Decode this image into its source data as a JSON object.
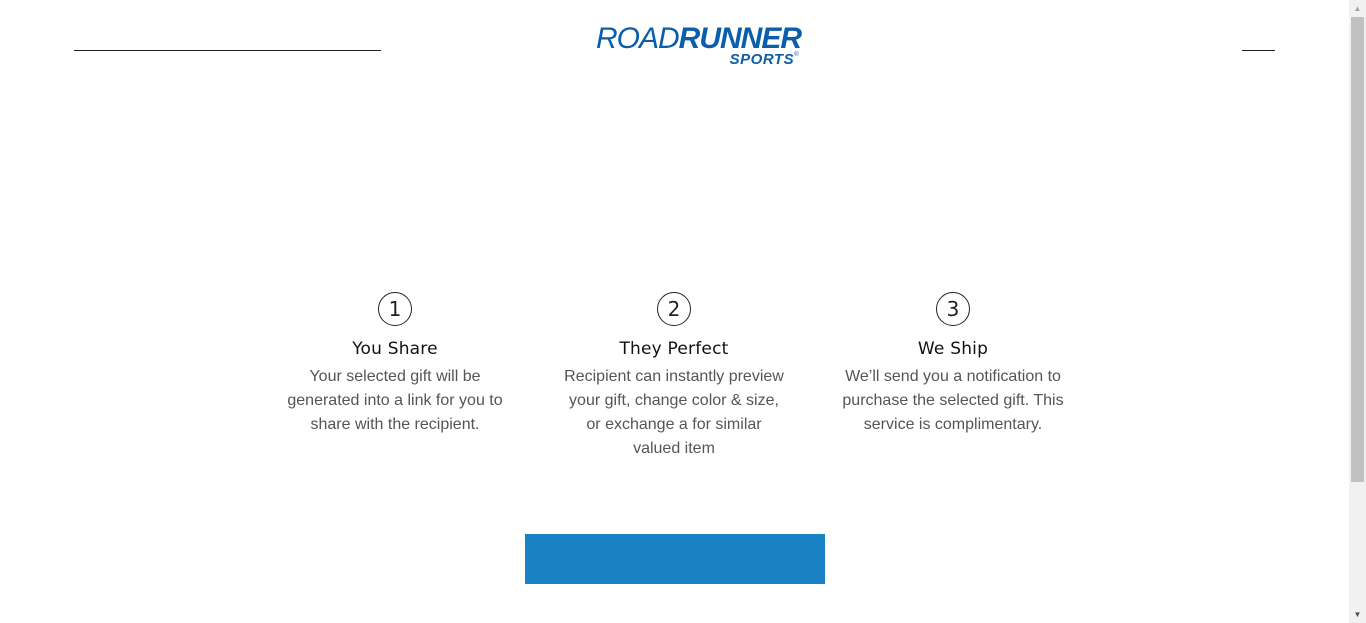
{
  "header": {
    "logo": {
      "road": "ROAD",
      "runner": "RUNNER",
      "sports": "SPORTS",
      "registered": "®"
    }
  },
  "steps": [
    {
      "number": "1",
      "title": "You Share",
      "description": "Your selected gift will be generated into a link for you to share with the recipient."
    },
    {
      "number": "2",
      "title": "They Perfect",
      "description": "Recipient can instantly preview your gift, change color & size, or exchange a for similar valued item"
    },
    {
      "number": "3",
      "title": "We Ship",
      "description": "We’ll send you a notification to purchase the selected gift. This service is complimentary."
    }
  ],
  "cta": {
    "label": ""
  },
  "colors": {
    "brand": "#0b5eab",
    "button": "#1a82c4"
  },
  "scrollbar": {
    "up_icon": "triangle-up-icon",
    "down_icon": "triangle-down-icon"
  }
}
